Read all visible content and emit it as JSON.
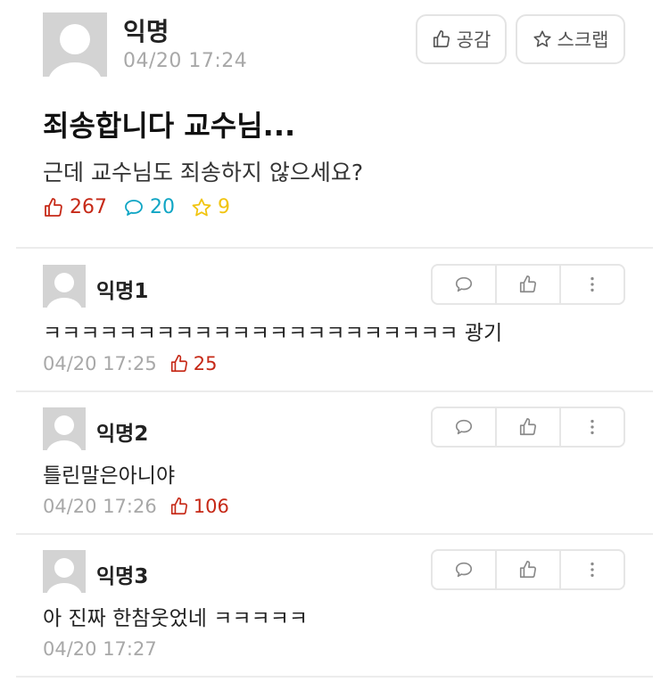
{
  "post": {
    "author": "익명",
    "date": "04/20 17:24",
    "like_button": "공감",
    "scrap_button": "스크랩",
    "title": "죄송합니다 교수님...",
    "body": "근데 교수님도 죄송하지 않으세요?",
    "stats": {
      "likes": "267",
      "comments": "20",
      "scraps": "9"
    }
  },
  "comments": [
    {
      "author": "익명1",
      "text": "ㅋㅋㅋㅋㅋㅋㅋㅋㅋㅋㅋㅋㅋㅋㅋㅋㅋㅋㅋㅋㅋㅋ 광기",
      "date": "04/20 17:25",
      "likes": "25"
    },
    {
      "author": "익명2",
      "text": "틀린말은아니야",
      "date": "04/20 17:26",
      "likes": "106"
    },
    {
      "author": "익명3",
      "text": "아 진짜 한참웃었네 ㅋㅋㅋㅋㅋ",
      "date": "04/20 17:27",
      "likes": null
    }
  ],
  "colors": {
    "like": "#c62917",
    "comment": "#0fa5c4",
    "scrap": "#f1c40f",
    "muted": "#a8a8a8"
  },
  "icons": [
    "avatar-icon",
    "thumbs-up-icon",
    "star-icon",
    "comment-icon",
    "more-icon"
  ]
}
